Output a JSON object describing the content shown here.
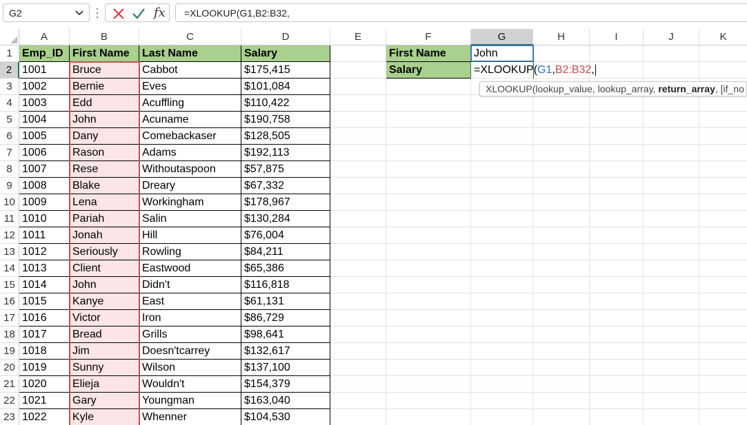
{
  "name_box": {
    "value": "G2"
  },
  "formula_bar": {
    "fx": "fx",
    "formula": "=XLOOKUP(G1,B2:B32,"
  },
  "columns": [
    "A",
    "B",
    "C",
    "D",
    "E",
    "F",
    "G",
    "H",
    "I",
    "J",
    "K"
  ],
  "selected_column": "G",
  "selected_row": "2",
  "table": {
    "headers": [
      "Emp_ID",
      "First Name",
      "Last Name",
      "Salary"
    ],
    "rows": [
      [
        "1001",
        "Bruce",
        "Cabbot",
        "$175,415"
      ],
      [
        "1002",
        "Bernie",
        "Eves",
        "$101,084"
      ],
      [
        "1003",
        "Edd",
        "Acuffling",
        "$110,422"
      ],
      [
        "1004",
        "John",
        "Acuname",
        "$190,758"
      ],
      [
        "1005",
        "Dany",
        "Comebackaser",
        "$128,505"
      ],
      [
        "1006",
        "Rason",
        "Adams",
        "$192,113"
      ],
      [
        "1007",
        "Rese",
        "Withoutaspoon",
        "$57,875"
      ],
      [
        "1008",
        "Blake",
        "Dreary",
        "$67,332"
      ],
      [
        "1009",
        "Lena",
        "Workingham",
        "$178,967"
      ],
      [
        "1010",
        "Pariah",
        "Salin",
        "$130,284"
      ],
      [
        "1011",
        "Jonah",
        "Hill",
        "$76,004"
      ],
      [
        "1012",
        "Seriously",
        "Rowling",
        "$84,211"
      ],
      [
        "1013",
        "Client",
        "Eastwood",
        "$65,386"
      ],
      [
        "1014",
        "John",
        "Didn't",
        "$116,818"
      ],
      [
        "1015",
        "Kanye",
        "East",
        "$61,131"
      ],
      [
        "1016",
        "Victor",
        "Iron",
        "$86,729"
      ],
      [
        "1017",
        "Bread",
        "Grills",
        "$98,641"
      ],
      [
        "1018",
        "Jim",
        "Doesn'tcarrey",
        "$132,617"
      ],
      [
        "1019",
        "Sunny",
        "Wilson",
        "$137,100"
      ],
      [
        "1020",
        "Elieja",
        "Wouldn't",
        "$154,379"
      ],
      [
        "1021",
        "Gary",
        "Youngman",
        "$163,040"
      ],
      [
        "1022",
        "Kyle",
        "Whenner",
        "$104,530"
      ]
    ]
  },
  "lookup": {
    "f1_label": "First Name",
    "g1_value": "John",
    "f2_label": "Salary",
    "g2_formula": {
      "prefix": "=XLOOKUP(",
      "ref1": "G1",
      "comma1": ",",
      "ref2": "B2:B32",
      "comma2": ","
    }
  },
  "tooltip": {
    "text_before": "XLOOKUP(lookup_value, lookup_array, ",
    "bold": "return_array",
    "text_after": ", [if_no"
  },
  "colors": {
    "header_fill": "#a9d08e",
    "lookup_range_fill": "#fbe5e6",
    "lookup_range_border": "#c0504d",
    "ref1_border": "#4472c4",
    "excel_green": "#217346"
  }
}
